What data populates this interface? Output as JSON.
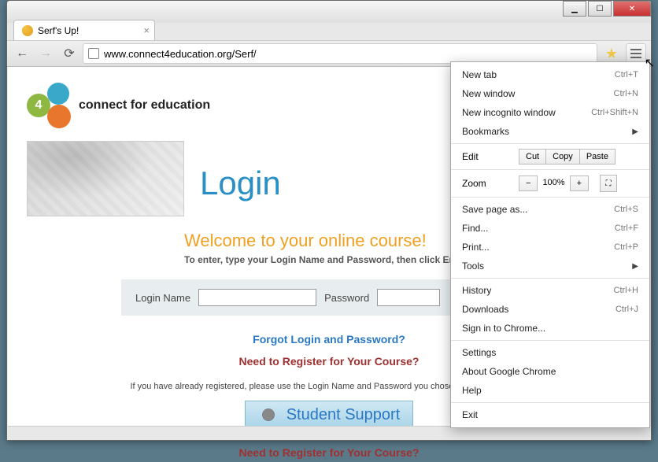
{
  "window": {
    "tab_title": "Serf's Up!",
    "url": "www.connect4education.org/Serf/"
  },
  "page": {
    "brand": "connect for education",
    "login_heading": "Login",
    "welcome": "Welcome to your online course!",
    "instruction": "To enter, type your Login Name and Password, then click Enter.",
    "login_name_label": "Login Name",
    "password_label": "Password",
    "forgot_link": "Forgot Login and Password?",
    "register_link": "Need to Register for Your Course?",
    "already_note": "If you have already registered, please use the Login Name and Password you chose during registration.",
    "support_label": "Student Support"
  },
  "ghost_text": "Need to Register for Your Course?",
  "menu": {
    "new_tab": "New tab",
    "new_tab_k": "Ctrl+T",
    "new_window": "New window",
    "new_window_k": "Ctrl+N",
    "incognito": "New incognito window",
    "incognito_k": "Ctrl+Shift+N",
    "bookmarks": "Bookmarks",
    "edit": "Edit",
    "cut": "Cut",
    "copy": "Copy",
    "paste": "Paste",
    "zoom": "Zoom",
    "zoom_val": "100%",
    "save_as": "Save page as...",
    "save_as_k": "Ctrl+S",
    "find": "Find...",
    "find_k": "Ctrl+F",
    "print": "Print...",
    "print_k": "Ctrl+P",
    "tools": "Tools",
    "history": "History",
    "history_k": "Ctrl+H",
    "downloads": "Downloads",
    "downloads_k": "Ctrl+J",
    "signin": "Sign in to Chrome...",
    "settings": "Settings",
    "about": "About Google Chrome",
    "help": "Help",
    "exit": "Exit"
  }
}
